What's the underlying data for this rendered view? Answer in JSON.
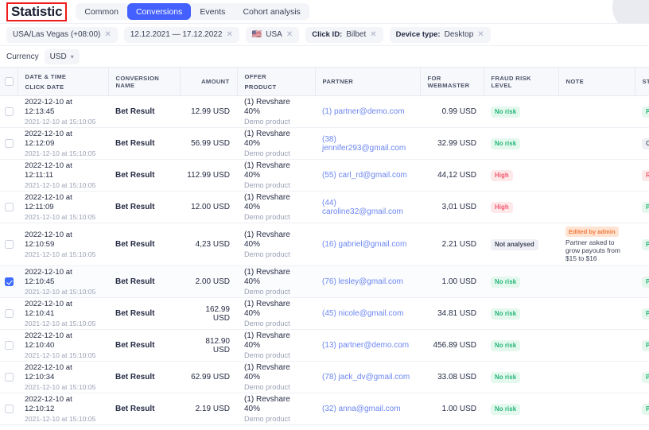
{
  "header": {
    "title": "Statistic",
    "tabs": [
      {
        "label": "Common",
        "active": false
      },
      {
        "label": "Conversions",
        "active": true
      },
      {
        "label": "Events",
        "active": false
      },
      {
        "label": "Cohort analysis",
        "active": false
      }
    ]
  },
  "filters": [
    {
      "key": "",
      "value": "USA/Las Vegas (+08:00)",
      "flag": ""
    },
    {
      "key": "",
      "value": "12.12.2021 — 17.12.2022",
      "flag": ""
    },
    {
      "key": "",
      "value": "USA",
      "flag": "🇺🇸"
    },
    {
      "key": "Click ID:",
      "value": "Bilbet",
      "flag": ""
    },
    {
      "key": "Device type:",
      "value": "Desktop",
      "flag": ""
    }
  ],
  "currency": {
    "label": "Currency",
    "value": "USD",
    "caret": "⌄"
  },
  "table": {
    "columns": {
      "date_time": "DATE & TIME",
      "click_date": "CLICK DATE",
      "conversion_name": "CONVERSION NAME",
      "amount": "AMOUNT",
      "offer": "OFFER",
      "product": "PRODUCT",
      "partner": "PARTNER",
      "for_webmaster": "FOR WEBMASTER",
      "fraud_risk_level": "FRAUD RISK LEVEL",
      "note": "NOTE",
      "status": "STATUS"
    },
    "rows": [
      {
        "checked": false,
        "checkbox_visible": true,
        "date_time": "2022-12-10 at 12:13:45",
        "click_date": "2021-12-10 at 15:10:05",
        "conversion_name": "Bet Result",
        "amount": "12.99 USD",
        "offer": "(1) Revshare 40%",
        "product": "Demo product",
        "partner": "(1) partner@demo.com",
        "for_webmaster": "0.99 USD",
        "fraud_risk": "No risk",
        "fraud_class": "b-norisk",
        "note_tag": "",
        "note_text": "",
        "status": "Paid",
        "status_class": "b-paid"
      },
      {
        "checked": false,
        "checkbox_visible": true,
        "date_time": "2022-12-10 at 12:12:09",
        "click_date": "2021-12-10 at 15:10:05",
        "conversion_name": "Bet Result",
        "amount": "56.99 USD",
        "offer": "(1) Revshare 40%",
        "product": "Demo product",
        "partner": "(38) jennifer293@gmail.com",
        "for_webmaster": "32.99 USD",
        "fraud_risk": "No risk",
        "fraud_class": "b-norisk",
        "note_tag": "",
        "note_text": "",
        "status": "On hold",
        "status_class": "b-onhold"
      },
      {
        "checked": false,
        "checkbox_visible": false,
        "date_time": "2022-12-10 at 12:11:11",
        "click_date": "2021-12-10 at 15:10:05",
        "conversion_name": "Bet Result",
        "amount": "112.99 USD",
        "offer": "(1) Revshare 40%",
        "product": "Demo product",
        "partner": "(55) carl_rd@gmail.com",
        "for_webmaster": "44,12 USD",
        "fraud_risk": "High",
        "fraud_class": "b-high",
        "note_tag": "",
        "note_text": "",
        "status": "Rejected",
        "status_class": "b-rejected"
      },
      {
        "checked": false,
        "checkbox_visible": true,
        "date_time": "2022-12-10 at 12:11:09",
        "click_date": "2021-12-10 at 15:10:05",
        "conversion_name": "Bet Result",
        "amount": "12.00 USD",
        "offer": "(1) Revshare 40%",
        "product": "Demo product",
        "partner": "(44) caroline32@gmail.com",
        "for_webmaster": "3,01 USD",
        "fraud_risk": "High",
        "fraud_class": "b-high",
        "note_tag": "",
        "note_text": "",
        "status": "Paid",
        "status_class": "b-paid"
      },
      {
        "checked": false,
        "checkbox_visible": true,
        "date_time": "2022-12-10 at 12:10:59",
        "click_date": "2021-12-10 at 15:10:05",
        "conversion_name": "Bet Result",
        "amount": "4,23 USD",
        "offer": "(1) Revshare 40%",
        "product": "Demo product",
        "partner": "(16) gabriel@gmail.com",
        "for_webmaster": "2.21 USD",
        "fraud_risk": "Not analysed",
        "fraud_class": "b-notan",
        "note_tag": "Edited by admin",
        "note_text": "Partner asked to grow payouts from $15 to $16",
        "status": "Paid",
        "status_class": "b-paid"
      },
      {
        "checked": true,
        "checkbox_visible": true,
        "date_time": "2022-12-10 at 12:10:45",
        "click_date": "2021-12-10 at 15:10:05",
        "conversion_name": "Bet Result",
        "amount": "2.00 USD",
        "offer": "(1) Revshare 40%",
        "product": "Demo product",
        "partner": "(76) lesley@gmail.com",
        "for_webmaster": "1.00 USD",
        "fraud_risk": "No risk",
        "fraud_class": "b-norisk",
        "note_tag": "",
        "note_text": "",
        "status": "Paid",
        "status_class": "b-paid"
      },
      {
        "checked": false,
        "checkbox_visible": true,
        "date_time": "2022-12-10 at 12:10:41",
        "click_date": "2021-12-10 at 15:10:05",
        "conversion_name": "Bet Result",
        "amount": "162.99 USD",
        "offer": "(1) Revshare 40%",
        "product": "Demo product",
        "partner": "(45) nicole@gmail.com",
        "for_webmaster": "34.81 USD",
        "fraud_risk": "No risk",
        "fraud_class": "b-norisk",
        "note_tag": "",
        "note_text": "",
        "status": "Paid",
        "status_class": "b-paid"
      },
      {
        "checked": false,
        "checkbox_visible": true,
        "date_time": "2022-12-10 at 12:10:40",
        "click_date": "2021-12-10 at 15:10:05",
        "conversion_name": "Bet Result",
        "amount": "812.90 USD",
        "offer": "(1) Revshare 40%",
        "product": "Demo product",
        "partner": "(13) partner@demo.com",
        "for_webmaster": "456.89 USD",
        "fraud_risk": "No risk",
        "fraud_class": "b-norisk",
        "note_tag": "",
        "note_text": "",
        "status": "Paid",
        "status_class": "b-paid"
      },
      {
        "checked": false,
        "checkbox_visible": true,
        "date_time": "2022-12-10 at 12:10:34",
        "click_date": "2021-12-10 at 15:10:05",
        "conversion_name": "Bet Result",
        "amount": "62.99 USD",
        "offer": "(1) Revshare 40%",
        "product": "Demo product",
        "partner": "(78) jack_dv@gmail.com",
        "for_webmaster": "33.08 USD",
        "fraud_risk": "No risk",
        "fraud_class": "b-norisk",
        "note_tag": "",
        "note_text": "",
        "status": "Paid",
        "status_class": "b-paid"
      },
      {
        "checked": false,
        "checkbox_visible": true,
        "date_time": "2022-12-10 at 12:10:12",
        "click_date": "2021-12-10 at 15:10:05",
        "conversion_name": "Bet Result",
        "amount": "2.19 USD",
        "offer": "(1) Revshare 40%",
        "product": "Demo product",
        "partner": "(32) anna@gmail.com",
        "for_webmaster": "1.00 USD",
        "fraud_risk": "No risk",
        "fraud_class": "b-norisk",
        "note_tag": "",
        "note_text": "",
        "status": "Paid",
        "status_class": "b-paid"
      }
    ]
  }
}
